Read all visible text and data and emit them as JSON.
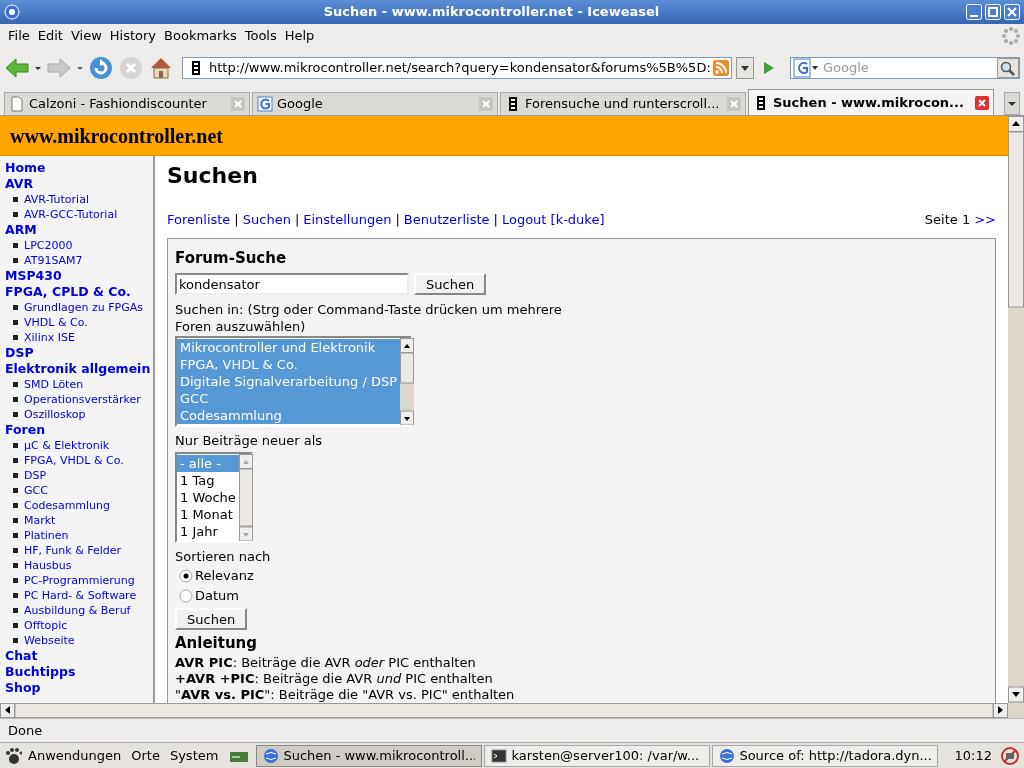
{
  "window": {
    "title": "Suchen - www.mikrocontroller.net - Iceweasel"
  },
  "menu": [
    "File",
    "Edit",
    "View",
    "History",
    "Bookmarks",
    "Tools",
    "Help"
  ],
  "toolbar": {
    "url": "http://www.mikrocontroller.net/search?query=kondensator&forums%5B%5D:",
    "search_placeholder": "Google"
  },
  "tabs": [
    {
      "label": "Calzoni - Fashiondiscounter",
      "selected": false,
      "kind": "page"
    },
    {
      "label": "Google",
      "selected": false,
      "kind": "google"
    },
    {
      "label": "Forensuche und runterscroll...",
      "selected": false,
      "kind": "site"
    },
    {
      "label": "Suchen - www.mikrocon...",
      "selected": true,
      "kind": "site"
    }
  ],
  "site": {
    "logo": "www.mikrocontroller.net"
  },
  "sidebar": [
    {
      "label": "Home"
    },
    {
      "label": "AVR",
      "children": [
        "AVR-Tutorial",
        "AVR-GCC-Tutorial"
      ]
    },
    {
      "label": "ARM",
      "children": [
        "LPC2000",
        "AT91SAM7"
      ]
    },
    {
      "label": "MSP430"
    },
    {
      "label": "FPGA, CPLD & Co.",
      "children": [
        "Grundlagen zu FPGAs",
        "VHDL & Co.",
        "Xilinx ISE"
      ]
    },
    {
      "label": "DSP"
    },
    {
      "label": "Elektronik allgemein",
      "children": [
        "SMD Löten",
        "Operationsverstärker",
        "Oszilloskop"
      ]
    },
    {
      "label": "Foren",
      "children": [
        "µC & Elektronik",
        "FPGA, VHDL & Co.",
        "DSP",
        "GCC",
        "Codesammlung",
        "Markt",
        "Platinen",
        "HF, Funk & Felder",
        "Hausbus",
        "PC-Programmierung",
        "PC Hard- & Software",
        "Ausbildung & Beruf",
        "Offtopic",
        "Webseite"
      ]
    },
    {
      "label": "Chat"
    },
    {
      "label": "Buchtipps"
    },
    {
      "label": "Shop"
    }
  ],
  "page": {
    "heading": "Suchen",
    "nav_links": [
      "Forenliste",
      "Suchen",
      "Einstellungen",
      "Benutzerliste",
      "Logout [k-duke]"
    ],
    "nav_separators": [
      "|",
      "|",
      "|",
      "|"
    ],
    "pager": {
      "label": "Seite 1",
      "next": ">>"
    },
    "form": {
      "title": "Forum-Suche",
      "query": "kondensator",
      "submit": "Suchen",
      "forums_label": "Suchen in: (Strg oder Command-Taste drücken um mehrere Foren auszuwählen)",
      "forums": [
        {
          "label": "Mikrocontroller und Elektronik",
          "selected": true
        },
        {
          "label": "FPGA, VHDL & Co.",
          "selected": true
        },
        {
          "label": "Digitale Signalverarbeitung / DSP",
          "selected": true
        },
        {
          "label": "GCC",
          "selected": true
        },
        {
          "label": "Codesammlung",
          "selected": true
        }
      ],
      "age_label": "Nur Beiträge neuer als",
      "ages": [
        {
          "label": "- alle -",
          "selected": true
        },
        {
          "label": "1 Tag",
          "selected": false
        },
        {
          "label": "1 Woche",
          "selected": false
        },
        {
          "label": "1 Monat",
          "selected": false
        },
        {
          "label": "1 Jahr",
          "selected": false
        }
      ],
      "sort_label": "Sortieren nach",
      "sort": [
        {
          "label": "Relevanz",
          "selected": true
        },
        {
          "label": "Datum",
          "selected": false
        }
      ],
      "submit2": "Suchen"
    },
    "help_title": "Anleitung",
    "help": [
      "**AVR PIC**: Beiträge die AVR *oder* PIC enthalten",
      "**+AVR +PIC**: Beiträge die AVR *und* PIC enthalten",
      "\"**AVR vs. PIC**\": Beiträge die \"AVR vs. PIC\" enthalten"
    ]
  },
  "status_bar": "Done",
  "taskbar": {
    "menus": [
      "Anwendungen",
      "Orte",
      "System"
    ],
    "tasks": [
      {
        "label": "Suchen - www.mikrocontroll...",
        "selected": true,
        "kind": "globe"
      },
      {
        "label": "karsten@server100: /var/w...",
        "selected": false,
        "kind": "terminal"
      },
      {
        "label": "Source of: http://tadora.dyn...",
        "selected": false,
        "kind": "globe"
      }
    ],
    "clock": "10:12"
  }
}
